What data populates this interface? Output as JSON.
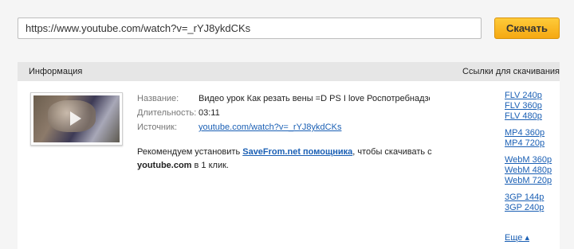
{
  "search": {
    "value": "https://www.youtube.com/watch?v=_rYJ8ykdCKs"
  },
  "download_button": "Скачать",
  "header": {
    "info": "Информация",
    "links": "Ссылки для скачивания"
  },
  "meta": {
    "title_label": "Название:",
    "title_value": "Видео урок Как резать вены =D  PS I love Роспотребнадзор",
    "duration_label": "Длительность:",
    "duration_value": "03:11",
    "source_label": "Источник:",
    "source_value": "youtube.com/watch?v=_rYJ8ykdCKs"
  },
  "recommend": {
    "prefix": "Рекомендуем установить ",
    "link": "SaveFrom.net помощника",
    "middle": ", чтобы скачивать с ",
    "site": "youtube.com",
    "suffix": " в 1 клик."
  },
  "links": {
    "flv": [
      "FLV 240p",
      "FLV 360p",
      "FLV 480p"
    ],
    "mp4": [
      "MP4 360p",
      "MP4 720p"
    ],
    "webm": [
      "WebM 360p",
      "WebM 480p",
      "WebM 720p"
    ],
    "gp3": [
      "3GP 144p",
      "3GP 240p"
    ],
    "more": "Еще ▴"
  }
}
